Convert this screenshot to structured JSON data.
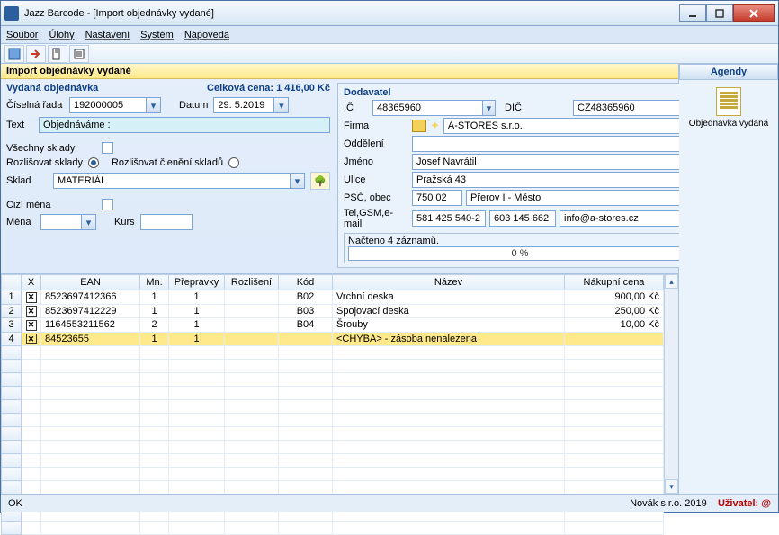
{
  "window": {
    "title": "Jazz Barcode - [Import objednávky vydané]"
  },
  "menu": {
    "soubor": "Soubor",
    "ulohy": "Úlohy",
    "nastaveni": "Nastavení",
    "system": "Systém",
    "napoveda": "Nápoveda"
  },
  "section": {
    "title": "Import objednávky vydané"
  },
  "order": {
    "header": "Vydaná objednávka",
    "total_label": "Celková cena:",
    "total_value": "1 416,00 Kč",
    "num_label": "Číselná řada",
    "num_value": "192000005",
    "date_label": "Datum",
    "date_value": "29. 5.2019",
    "text_label": "Text",
    "text_value": "Objednáváme :",
    "all_wh": "Všechny sklady",
    "diff_wh": "Rozlišovat sklady",
    "diff_wh_det": "Rozlišovat členění skladů",
    "wh_label": "Sklad",
    "wh_value": "MATERIÁL",
    "fc_label": "Cizí měna",
    "cur_label": "Měna",
    "rate_label": "Kurs"
  },
  "supplier": {
    "header": "Dodavatel",
    "ic_label": "IČ",
    "ic_value": "48365960",
    "dic_label": "DIČ",
    "dic_value": "CZ48365960",
    "firma_label": "Firma",
    "firma_value": "A-STORES s.r.o.",
    "odd_label": "Oddělení",
    "odd_value": "",
    "jmeno_label": "Jméno",
    "jmeno_value": "Josef Navrátil",
    "ulice_label": "Ulice",
    "ulice_value": "Pražská 43",
    "psc_label": "PSČ, obec",
    "psc_value": "750 02",
    "obec_value": "Přerov I - Město",
    "kontakt_label": "Tel,GSM,e-mail",
    "tel_value": "581 425 540-2",
    "gsm_value": "603 145 662",
    "mail_value": "info@a-stores.cz",
    "loaded": "Načteno 4 záznamů.",
    "progress": "0 %"
  },
  "grid": {
    "cols": {
      "x": "X",
      "ean": "EAN",
      "mn": "Mn.",
      "prep": "Přepravky",
      "rozl": "Rozlišení",
      "kod": "Kód",
      "nazev": "Název",
      "cena": "Nákupní cena"
    },
    "rows": [
      {
        "n": "1",
        "ean": "8523697412366",
        "mn": "1",
        "prep": "1",
        "rozl": "",
        "kod": "B02",
        "nazev": "Vrchní deska",
        "cena": "900,00 Kč"
      },
      {
        "n": "2",
        "ean": "8523697412229",
        "mn": "1",
        "prep": "1",
        "rozl": "",
        "kod": "B03",
        "nazev": "Spojovací deska",
        "cena": "250,00 Kč"
      },
      {
        "n": "3",
        "ean": "1164553211562",
        "mn": "2",
        "prep": "1",
        "rozl": "",
        "kod": "B04",
        "nazev": "Šrouby",
        "cena": "10,00 Kč"
      },
      {
        "n": "4",
        "ean": "84523655",
        "mn": "1",
        "prep": "1",
        "rozl": "",
        "kod": "",
        "nazev": "<CHYBA> - zásoba nenalezena",
        "cena": ""
      }
    ]
  },
  "side": {
    "header": "Agendy",
    "item": "Objednávka vydaná"
  },
  "status": {
    "ok": "OK",
    "company": "Novák s.r.o. 2019",
    "user_label": "Uživatel:",
    "user": "@"
  }
}
